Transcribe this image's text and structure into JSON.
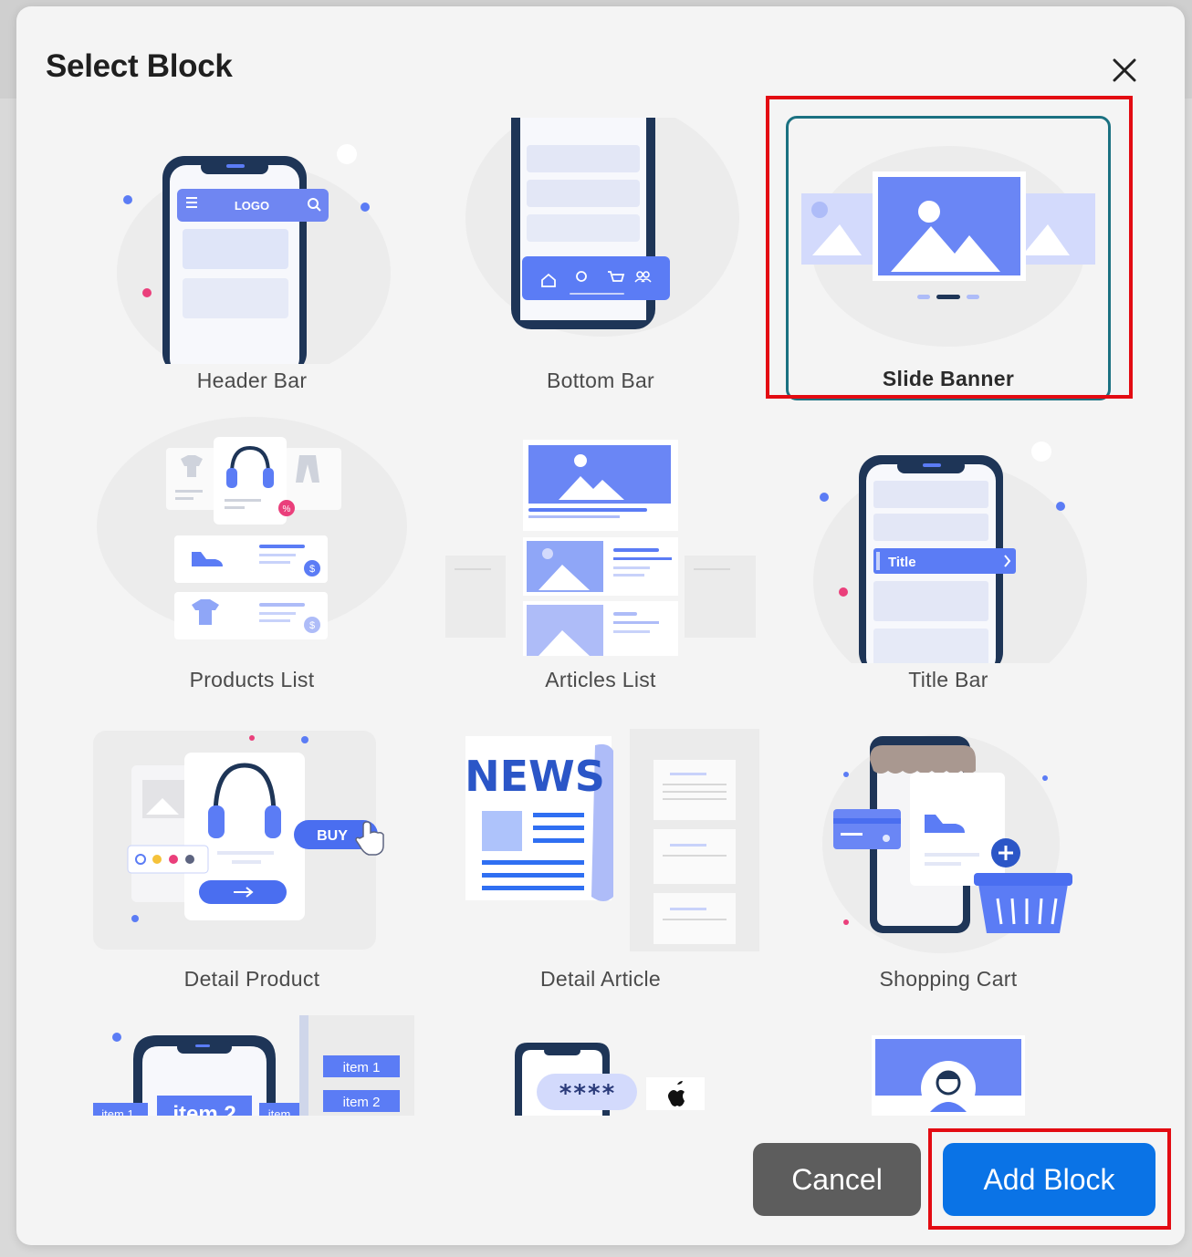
{
  "modal": {
    "title": "Select Block",
    "close_icon": "close-icon"
  },
  "blocks": [
    {
      "label": "Header Bar",
      "icon": "header-bar-illustration",
      "logo_text": "LOGO",
      "selected": false
    },
    {
      "label": "Bottom Bar",
      "icon": "bottom-bar-illustration",
      "selected": false
    },
    {
      "label": "Slide Banner",
      "icon": "slide-banner-illustration",
      "selected": true
    },
    {
      "label": "Products List",
      "icon": "products-list-illustration",
      "selected": false
    },
    {
      "label": "Articles List",
      "icon": "articles-list-illustration",
      "selected": false
    },
    {
      "label": "Title Bar",
      "icon": "title-bar-illustration",
      "title_text": "Title",
      "selected": false
    },
    {
      "label": "Detail Product",
      "icon": "detail-product-illustration",
      "buy_text": "BUY",
      "selected": false
    },
    {
      "label": "Detail Article",
      "icon": "detail-article-illustration",
      "news_text": "NEWS",
      "selected": false
    },
    {
      "label": "Shopping Cart",
      "icon": "shopping-cart-illustration",
      "selected": false
    },
    {
      "label": "",
      "icon": "tabs-illustration",
      "tab_labels": [
        "item 1",
        "item 2",
        "item",
        "item 1",
        "item 2"
      ],
      "selected": false
    },
    {
      "label": "",
      "icon": "login-illustration",
      "password_mask": "****",
      "selected": false
    },
    {
      "label": "",
      "icon": "profile-illustration",
      "selected": false
    }
  ],
  "footer": {
    "cancel_label": "Cancel",
    "add_label": "Add Block"
  },
  "colors": {
    "accent": "#0a73e6",
    "selected_border": "#1b7181",
    "highlight": "#e30b12",
    "illustration_blue": "#5b7cf5",
    "phone_frame": "#1e3557"
  }
}
